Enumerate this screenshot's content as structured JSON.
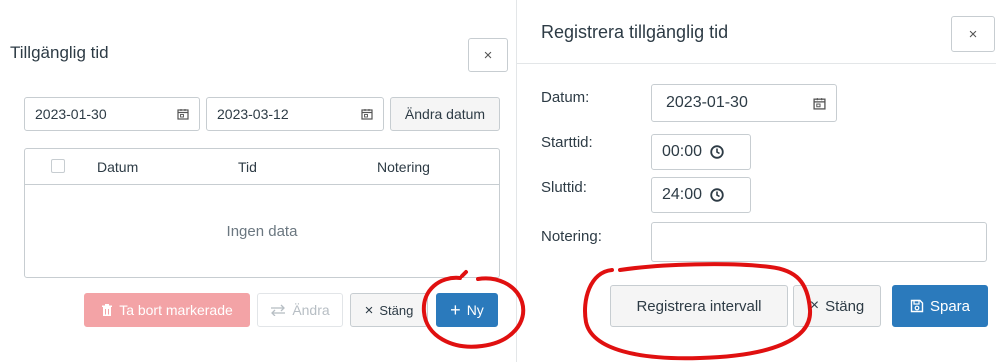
{
  "left_dialog": {
    "title": "Tillgänglig tid",
    "close_glyph": "×",
    "date_from": "2023-01-30",
    "date_to": "2023-03-12",
    "change_dates_label": "Ändra datum",
    "table": {
      "columns": [
        "Datum",
        "Tid",
        "Notering"
      ],
      "empty_text": "Ingen data"
    },
    "footer": {
      "delete_label": "Ta bort markerade",
      "edit_label": "Ändra",
      "close_label": "Stäng",
      "new_label": "Ny"
    }
  },
  "right_dialog": {
    "title": "Registrera tillgänglig tid",
    "close_glyph": "×",
    "date_label": "Datum:",
    "date_value": "2023-01-30",
    "start_label": "Starttid:",
    "start_value": "00:00",
    "end_label": "Sluttid:",
    "end_value": "24:00",
    "note_label": "Notering:",
    "note_value": "",
    "footer": {
      "interval_label": "Registrera intervall",
      "close_label": "Stäng",
      "save_label": "Spara"
    }
  },
  "colors": {
    "primary": "#2b7abc",
    "danger_disabled": "#f3a3a6",
    "annotation_red": "#e01010"
  },
  "icons": [
    "close-icon",
    "calendar-icon",
    "clock-icon",
    "trash-icon",
    "swap-arrows-icon",
    "plus-icon",
    "save-icon"
  ]
}
